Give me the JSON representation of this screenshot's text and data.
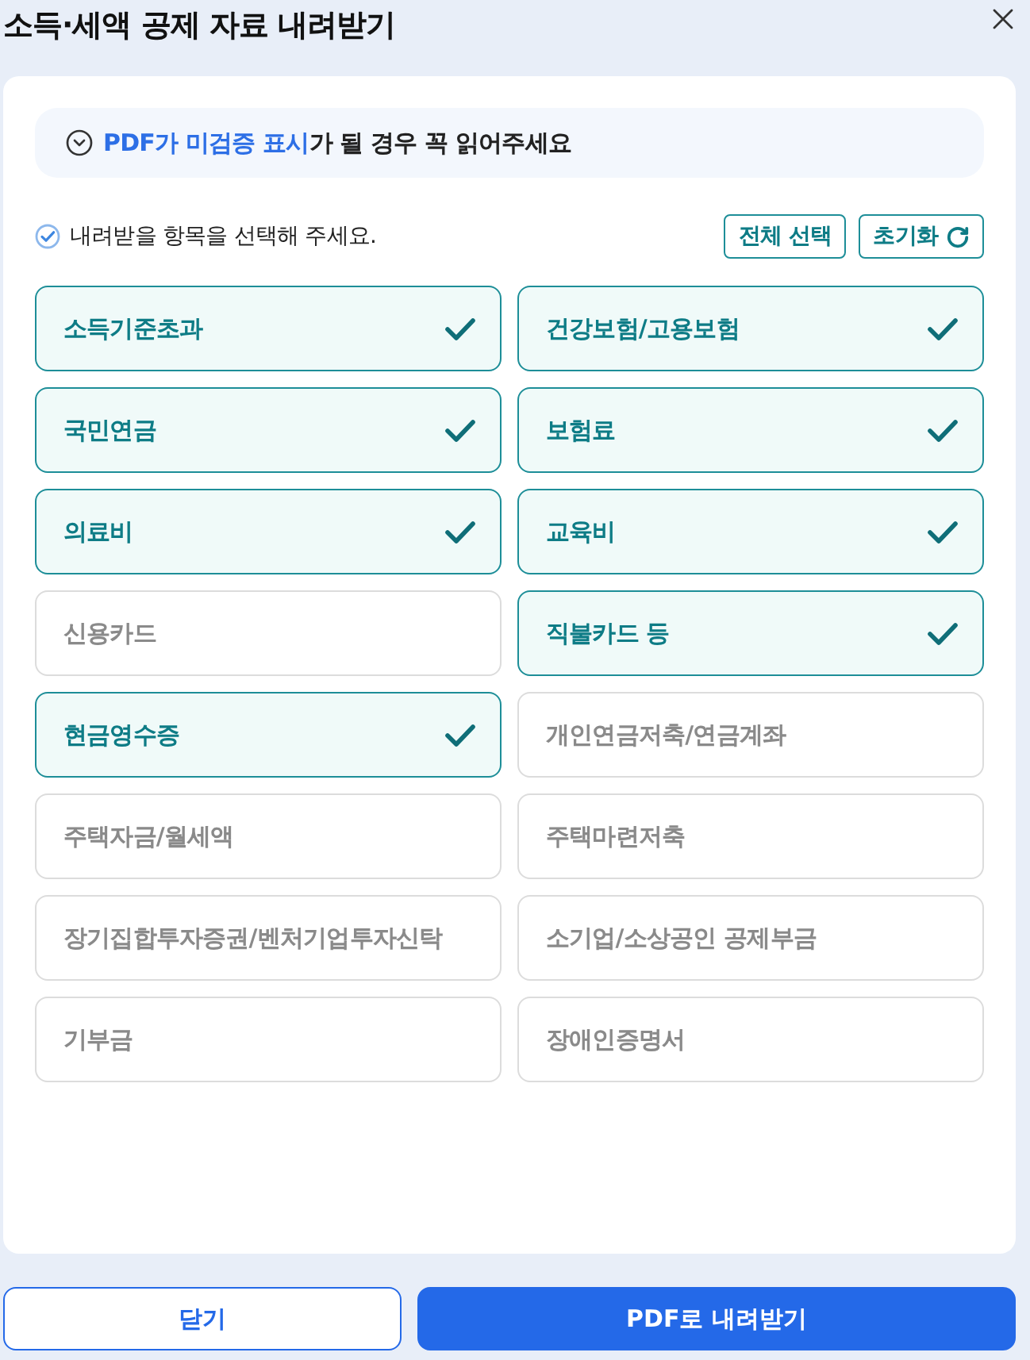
{
  "dialog": {
    "title": "소득·세액 공제 자료 내려받기"
  },
  "notice": {
    "highlight": "PDF가 미검증 표시",
    "text": "가 될 경우 꼭 읽어주세요",
    "expanded": false
  },
  "selection": {
    "instruction": "내려받을 항목을 선택해 주세요.",
    "select_all_button": "전체 선택",
    "reset_button": "초기화"
  },
  "items": [
    {
      "label": "소득기준초과",
      "selected": true
    },
    {
      "label": "건강보험/고용보험",
      "selected": true
    },
    {
      "label": "국민연금",
      "selected": true
    },
    {
      "label": "보험료",
      "selected": true
    },
    {
      "label": "의료비",
      "selected": true
    },
    {
      "label": "교육비",
      "selected": true
    },
    {
      "label": "신용카드",
      "selected": false
    },
    {
      "label": "직불카드 등",
      "selected": true
    },
    {
      "label": "현금영수증",
      "selected": true
    },
    {
      "label": "개인연금저축/연금계좌",
      "selected": false
    },
    {
      "label": "주택자금/월세액",
      "selected": false
    },
    {
      "label": "주택마련저축",
      "selected": false
    },
    {
      "label": "장기집합투자증권/벤처기업투자신탁",
      "selected": false
    },
    {
      "label": "소기업/소상공인 공제부금",
      "selected": false
    },
    {
      "label": "기부금",
      "selected": false
    },
    {
      "label": "장애인증명서",
      "selected": false
    }
  ],
  "buttons": [
    {
      "label": "닫기",
      "kind": "secondary"
    },
    {
      "label": "PDF로 내려받기",
      "kind": "primary"
    }
  ]
}
